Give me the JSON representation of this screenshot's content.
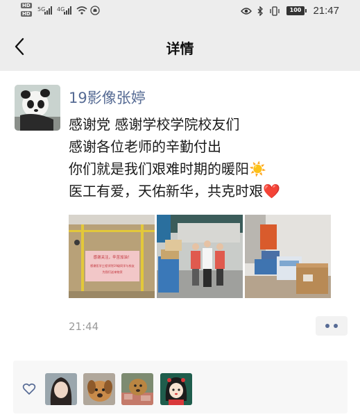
{
  "status_bar": {
    "hd_top": "HD",
    "hd_bottom": "HD",
    "signal1_label": "5G",
    "signal2_label": "4G",
    "battery": "100",
    "time": "21:47"
  },
  "header": {
    "title": "详情"
  },
  "post": {
    "author": "19影像张婷",
    "lines": [
      "感谢党 感谢学校学院校友们",
      "感谢各位老师的辛勤付出",
      "你们就是我们艰难时期的暖阳☀️",
      "医工有爱，天佑新华，共克时艰❤️"
    ],
    "photos": [
      "donation-box-with-note",
      "volunteers-with-supplies",
      "stacked-supply-boxes"
    ],
    "photo_note_lines": [
      "感谢关注，辛苦加油！",
      "感谢医学工程学院19级同学与校友",
      "为我们送来物资"
    ],
    "time": "21:44"
  },
  "likes": {
    "avatars": [
      "girl-portrait",
      "dog-photo",
      "dog-with-money",
      "cartoon-girl"
    ]
  },
  "colors": {
    "header_bg": "#ededed",
    "link_blue": "#566b94",
    "likes_bg": "#f7f7f7"
  }
}
